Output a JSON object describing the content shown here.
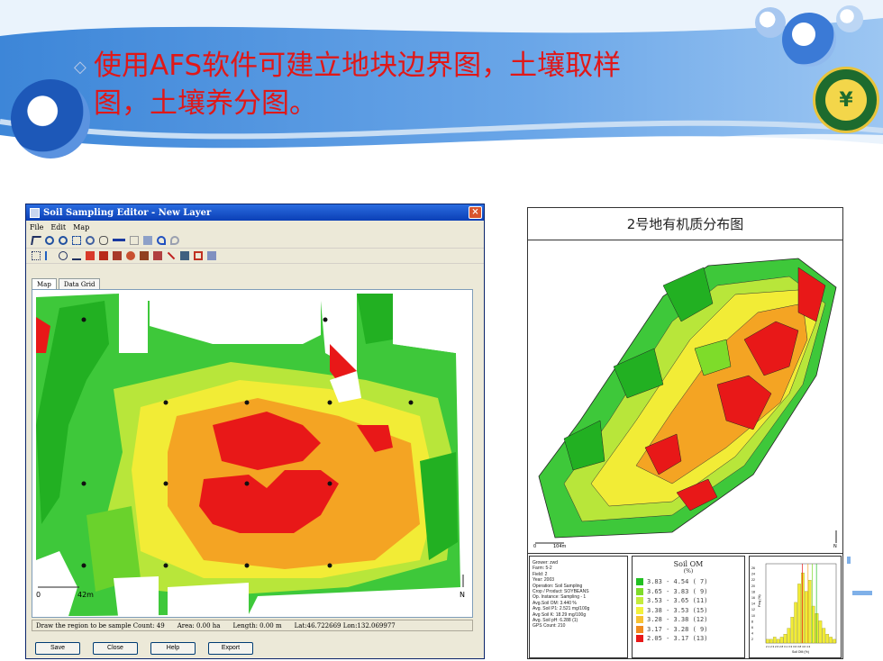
{
  "slide": {
    "title_line1": "使用AFS软件可建立地块边界图，土壤取样",
    "title_line2": "图，土壤养分图。",
    "bullet": "◇"
  },
  "logo": {
    "glyph": "¥"
  },
  "window": {
    "title": "Soil Sampling Editor - New Layer",
    "close": "×",
    "menus": [
      "File",
      "Edit",
      "Map"
    ],
    "tabs": [
      "Map",
      "Data Grid"
    ],
    "scale_label": "42m",
    "scale_zero": "0",
    "north": "N",
    "status": {
      "draw": "Draw the region to be sample Count: 49",
      "area": "Area: 0.00 ha",
      "length": "Length: 0.00 m",
      "latlon": "Lat:46.722669  Lon:132.069977"
    },
    "buttons": [
      "Save",
      "Close",
      "Help",
      "Export"
    ]
  },
  "figure": {
    "title": "2号地有机质分布图",
    "scale_zero": "0",
    "scale_label": "104m",
    "north": "N",
    "info_lines": [
      "Grower: zwd",
      "Farm: 5-2",
      "Field: 2",
      "Year: 2003",
      "Operation: Soil Sampling",
      "Crop / Product: SOYBEANS",
      "Op. Instance: Sampling - 1",
      "Avg.Soil OM: 3.440 %",
      "Avg. Soil P1: 2.521 mg/100g",
      "Avg Soil K: 18.29 mg/100g",
      "Avg. Soil pH: 6.288 (1)",
      "GPS Count: 210"
    ],
    "legend": {
      "title": "Soil OM",
      "subtitle": "(%)",
      "rows": [
        {
          "range": "3.83 - 4.54 ( 7)",
          "color": "#22c022"
        },
        {
          "range": "3.65 - 3.83 ( 9)",
          "color": "#7edc2a"
        },
        {
          "range": "3.53 - 3.65 (11)",
          "color": "#c4ec3c"
        },
        {
          "range": "3.38 - 3.53 (15)",
          "color": "#f2f23c"
        },
        {
          "range": "3.28 - 3.38 (12)",
          "color": "#f7c233"
        },
        {
          "range": "3.17 - 3.28 ( 9)",
          "color": "#f08a1e"
        },
        {
          "range": "2.05 - 3.17 (13)",
          "color": "#e81818"
        }
      ]
    },
    "hist": {
      "ylabel": "Freq (%)",
      "xlabel": "Soil OM (%)",
      "yticks": [
        "26",
        "24",
        "22",
        "20",
        "18",
        "16",
        "14",
        "12",
        "10",
        "8",
        "6",
        "4",
        "2"
      ],
      "xticks": "2.1 2.3 2.6 2.8 3.1 3.3 3.6 3.8 4.0 4.3",
      "bars": [
        0.05,
        0.05,
        0.08,
        0.05,
        0.08,
        0.12,
        0.2,
        0.35,
        0.55,
        0.8,
        0.95,
        0.7,
        0.85,
        0.5,
        0.4,
        0.3,
        0.2,
        0.12,
        0.08,
        0.05
      ]
    }
  }
}
